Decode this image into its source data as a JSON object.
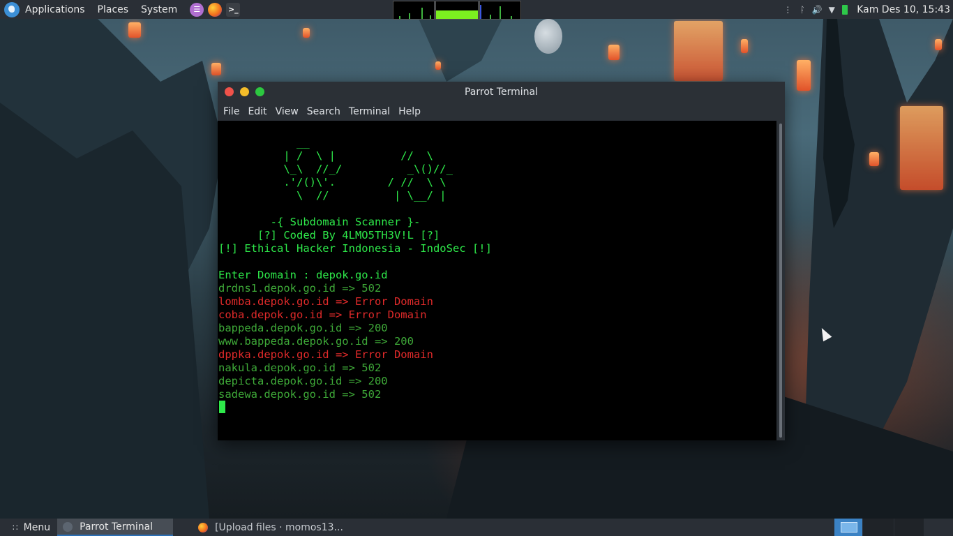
{
  "top_panel": {
    "menus": [
      "Applications",
      "Places",
      "System"
    ],
    "launchers": [
      "text-editor-icon",
      "firefox-icon",
      "terminal-icon"
    ],
    "clock": "Kam Des 10, 15:43"
  },
  "window": {
    "title": "Parrot Terminal",
    "menu": [
      "File",
      "Edit",
      "View",
      "Search",
      "Terminal",
      "Help"
    ]
  },
  "terminal": {
    "lines": [
      {
        "text": "            __",
        "color": "green"
      },
      {
        "text": "          | /  \\ |          //  \\",
        "color": "green"
      },
      {
        "text": "          \\_\\  //_/          _\\()//_",
        "color": "green"
      },
      {
        "text": "          .'/()\\'.        / //  \\ \\",
        "color": "green"
      },
      {
        "text": "            \\  //          | \\__/ |",
        "color": "green"
      },
      {
        "text": "",
        "color": "green"
      },
      {
        "text": "        -{ Subdomain Scanner }-",
        "color": "green"
      },
      {
        "text": "      [?] Coded By 4LMO5TH3V!L [?]",
        "color": "green"
      },
      {
        "text": "[!] Ethical Hacker Indonesia - IndoSec [!]",
        "color": "green"
      },
      {
        "text": "",
        "color": "green"
      },
      {
        "text": "Enter Domain : depok.go.id",
        "color": "green"
      },
      {
        "text": "drdns1.depok.go.id => 502",
        "color": "darkgreen"
      },
      {
        "text": "lomba.depok.go.id => Error Domain",
        "color": "red"
      },
      {
        "text": "coba.depok.go.id => Error Domain",
        "color": "red"
      },
      {
        "text": "bappeda.depok.go.id => 200",
        "color": "darkgreen"
      },
      {
        "text": "www.bappeda.depok.go.id => 200",
        "color": "darkgreen"
      },
      {
        "text": "dppka.depok.go.id => Error Domain",
        "color": "red"
      },
      {
        "text": "nakula.depok.go.id => 502",
        "color": "darkgreen"
      },
      {
        "text": "depicta.depok.go.id => 200",
        "color": "darkgreen"
      },
      {
        "text": "sadewa.depok.go.id => 502",
        "color": "darkgreen"
      }
    ]
  },
  "taskbar": {
    "menu_label": "Menu",
    "tasks": [
      {
        "label": "Parrot Terminal",
        "active": true
      },
      {
        "label": "[Upload files · momos13...",
        "active": false
      }
    ]
  },
  "colors": {
    "terminal_green": "#2ee94a",
    "terminal_darkgreen": "#3ea938",
    "terminal_red": "#e02a2a",
    "panel_bg": "#2a2f36"
  }
}
